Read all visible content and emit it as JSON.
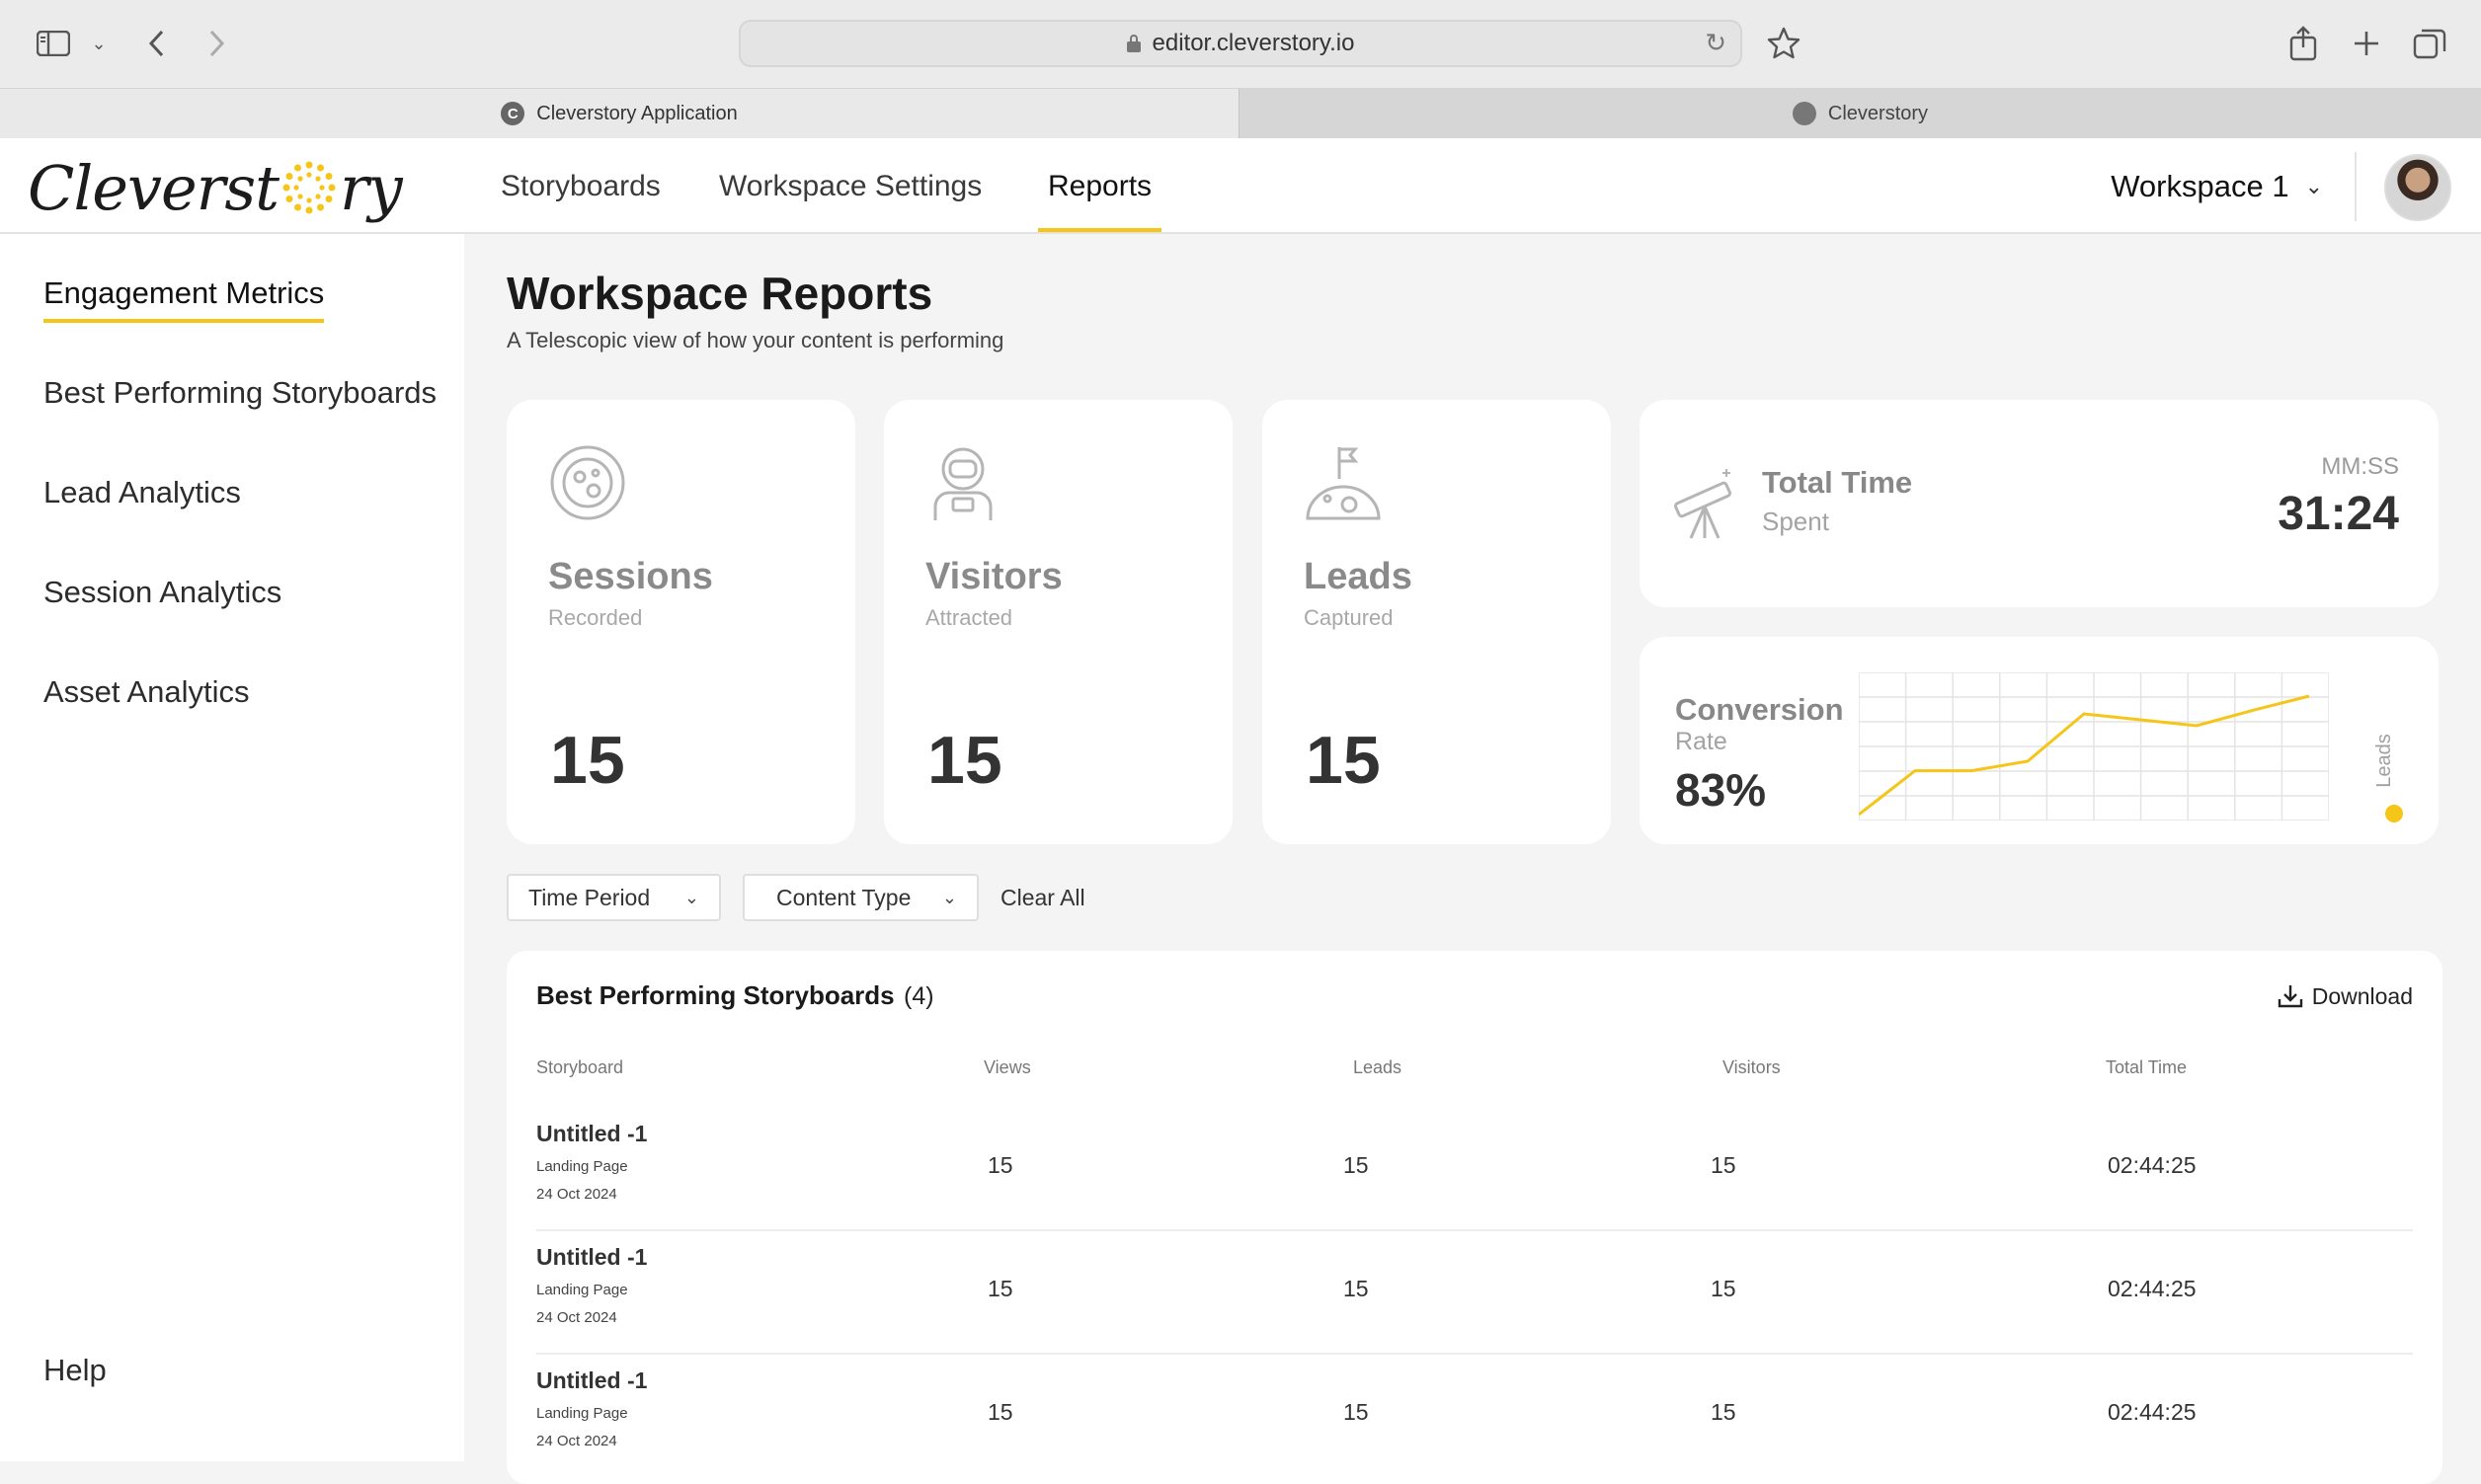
{
  "browser": {
    "url": "editor.cleverstory.io",
    "tabs": [
      {
        "label": "Cleverstory Application",
        "favicon": "C"
      },
      {
        "label": "Cleverstory"
      }
    ]
  },
  "header": {
    "logo_text": "Cleverstory",
    "nav": [
      {
        "label": "Storyboards"
      },
      {
        "label": "Workspace Settings"
      },
      {
        "label": "Reports",
        "active": true
      }
    ],
    "workspace": "Workspace 1"
  },
  "sidebar": {
    "items": [
      {
        "label": "Engagement Metrics",
        "active": true
      },
      {
        "label": "Best Performing Storyboards"
      },
      {
        "label": "Lead Analytics"
      },
      {
        "label": "Session Analytics"
      },
      {
        "label": "Asset Analytics"
      }
    ],
    "help": "Help"
  },
  "page": {
    "title": "Workspace Reports",
    "subtitle": "A Telescopic view of how your content is performing"
  },
  "stats": [
    {
      "label": "Sessions",
      "sub": "Recorded",
      "value": "15",
      "icon": "planet-icon"
    },
    {
      "label": "Visitors",
      "sub": "Attracted",
      "value": "15",
      "icon": "astronaut-icon"
    },
    {
      "label": "Leads",
      "sub": "Captured",
      "value": "15",
      "icon": "moon-flag-icon"
    }
  ],
  "total_time": {
    "label": "Total Time",
    "sub": "Spent",
    "unit": "MM:SS",
    "value": "31:24",
    "icon": "telescope-icon"
  },
  "conversion": {
    "label": "Conversion",
    "sub": "Rate",
    "value": "83%",
    "legend": "Leads",
    "accent": "#f5c518",
    "trend": [
      0,
      0.37,
      0.37,
      0.45,
      0.85,
      0.8,
      0.75,
      0.88,
      1.0
    ]
  },
  "filters": {
    "time_period": "Time Period",
    "content_type": "Content Type",
    "clear_all": "Clear All"
  },
  "table": {
    "title": "Best Performing Storyboards",
    "count": "(4)",
    "download": "Download",
    "headers": {
      "storyboard": "Storyboard",
      "views": "Views",
      "leads": "Leads",
      "visitors": "Visitors",
      "total_time": "Total Time"
    },
    "rows": [
      {
        "name": "Untitled -1",
        "type": "Landing Page",
        "date": "24 Oct 2024",
        "views": "15",
        "leads": "15",
        "visitors": "15",
        "total_time": "02:44:25"
      },
      {
        "name": "Untitled -1",
        "type": "Landing Page",
        "date": "24 Oct 2024",
        "views": "15",
        "leads": "15",
        "visitors": "15",
        "total_time": "02:44:25"
      },
      {
        "name": "Untitled -1",
        "type": "Landing Page",
        "date": "24 Oct 2024",
        "views": "15",
        "leads": "15",
        "visitors": "15",
        "total_time": "02:44:25"
      }
    ]
  }
}
